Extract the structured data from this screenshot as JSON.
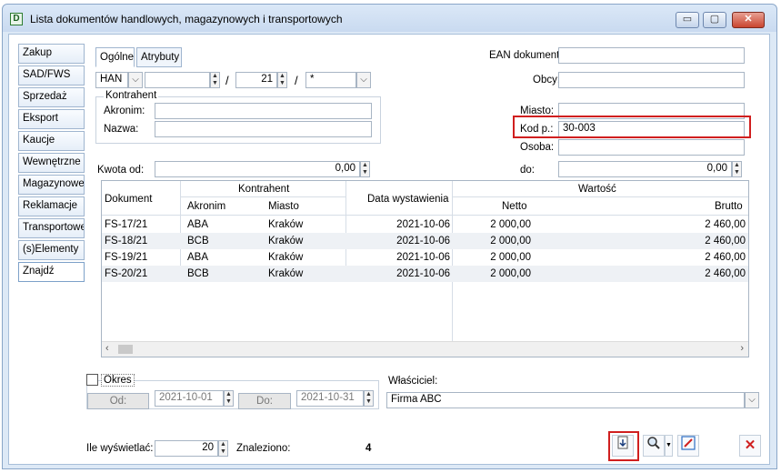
{
  "window": {
    "title": "Lista dokumentów handlowych, magazynowych i transportowych",
    "minimize": "▭",
    "maximize": "▢",
    "close": "✕"
  },
  "sidebar": {
    "items": [
      {
        "label": "Zakup"
      },
      {
        "label": "SAD/FWS"
      },
      {
        "label": "Sprzedaż"
      },
      {
        "label": "Eksport"
      },
      {
        "label": "Kaucje"
      },
      {
        "label": "Wewnętrzne"
      },
      {
        "label": "Magazynowe"
      },
      {
        "label": "Reklamacje"
      },
      {
        "label": "Transportowe"
      },
      {
        "label": "(s)Elementy"
      },
      {
        "label": "Znajdź"
      }
    ]
  },
  "tabs": [
    {
      "label": "Ogólne"
    },
    {
      "label": "Atrybuty"
    }
  ],
  "filters": {
    "ean_label": "EAN dokumentu:",
    "ean_value": "",
    "doc_type": "HAN",
    "doc_number": "",
    "slash1": "/",
    "year": "21",
    "slash2": "/",
    "series": "*",
    "obcy_label": "Obcy:",
    "obcy_value": "",
    "kontrahent_group": "Kontrahent",
    "akronim_label": "Akronim:",
    "akronim_value": "",
    "nazwa_label": "Nazwa:",
    "nazwa_value": "",
    "miasto_label": "Miasto:",
    "miasto_value": "",
    "kod_label": "Kod p.:",
    "kod_value": "30-003",
    "osoba_label": "Osoba:",
    "osoba_value": "",
    "kwota_label": "Kwota od:",
    "kwota_od": "0,00",
    "do_label": "do:",
    "kwota_do": "0,00"
  },
  "table": {
    "headers": {
      "dokument": "Dokument",
      "kontrahent": "Kontrahent",
      "akronim": "Akronim",
      "miasto": "Miasto",
      "data": "Data wystawienia",
      "wartosc": "Wartość",
      "netto": "Netto",
      "brutto": "Brutto"
    },
    "rows": [
      {
        "dokument": "FS-17/21",
        "akronim": "ABA",
        "miasto": "Kraków",
        "data": "2021-10-06",
        "netto": "2 000,00",
        "brutto": "2 460,00"
      },
      {
        "dokument": "FS-18/21",
        "akronim": "BCB",
        "miasto": "Kraków",
        "data": "2021-10-06",
        "netto": "2 000,00",
        "brutto": "2 460,00"
      },
      {
        "dokument": "FS-19/21",
        "akronim": "ABA",
        "miasto": "Kraków",
        "data": "2021-10-06",
        "netto": "2 000,00",
        "brutto": "2 460,00"
      },
      {
        "dokument": "FS-20/21",
        "akronim": "BCB",
        "miasto": "Kraków",
        "data": "2021-10-06",
        "netto": "2 000,00",
        "brutto": "2 460,00"
      }
    ]
  },
  "period": {
    "okres_label": "Okres",
    "od_label": "Od:",
    "od_value": "2021-10-01",
    "do_label": "Do:",
    "do_value": "2021-10-31"
  },
  "owner": {
    "label": "Właściciel:",
    "value": "Firma ABC"
  },
  "footer": {
    "ile_label": "Ile wyświetlać:",
    "ile_value": "20",
    "znaleziono_label": "Znaleziono:",
    "znaleziono_value": "4"
  },
  "colors": {
    "highlight": "#d01f1f",
    "window_bg": "#dde9f6",
    "border": "#a8b5c4"
  },
  "icons": [
    "app-icon",
    "export-icon",
    "search-icon",
    "edit-icon",
    "close-icon"
  ]
}
